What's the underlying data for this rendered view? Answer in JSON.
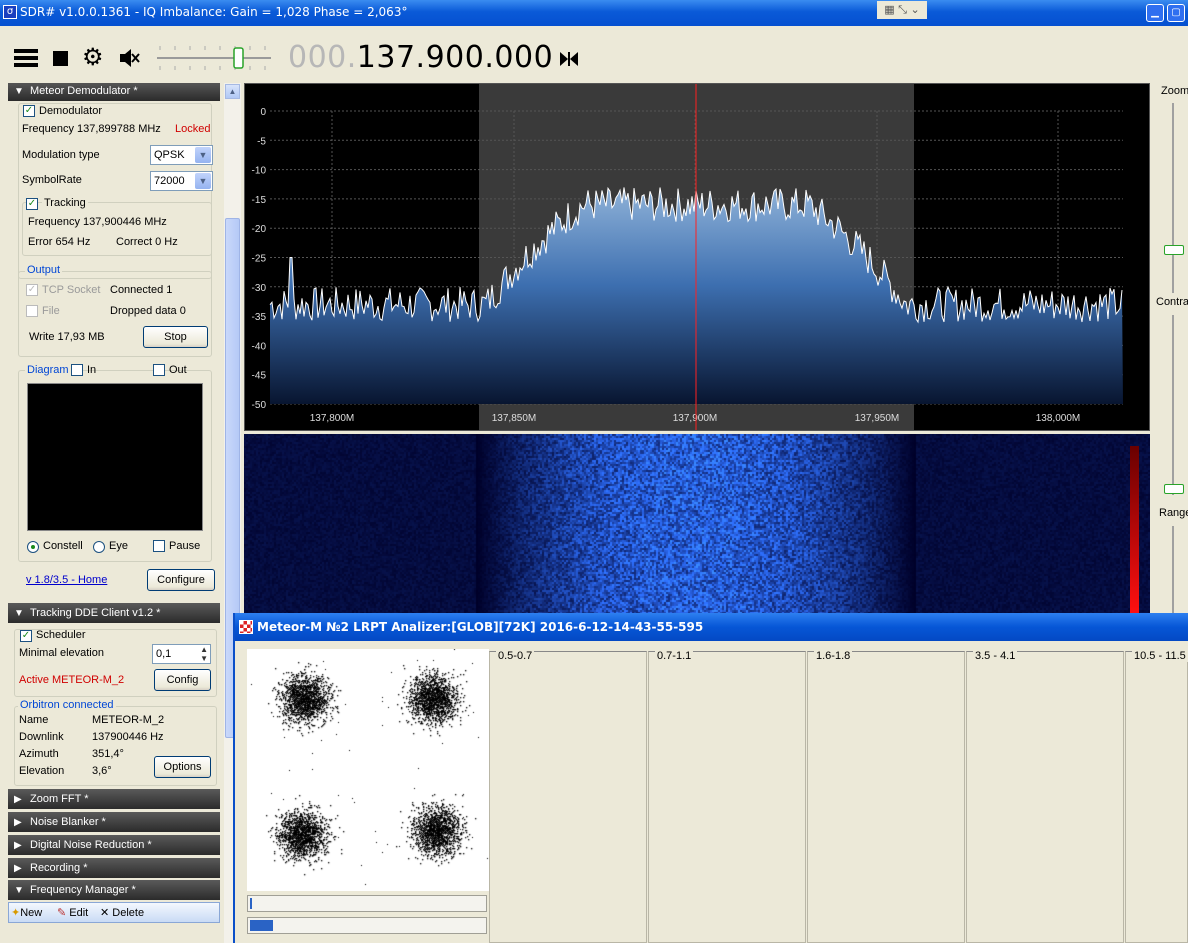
{
  "window": {
    "title": "SDR# v1.0.0.1361 - IQ Imbalance: Gain = 1,028 Phase = 2,063°"
  },
  "toolbar": {
    "freq_dim": "000.",
    "freq_main": "137.900.000"
  },
  "meteor": {
    "header": "Meteor Demodulator *",
    "demodulator_label": "Demodulator",
    "frequency_text": "Frequency 137,899788 MHz",
    "locked": "Locked",
    "modulation_label": "Modulation type",
    "modulation_value": "QPSK",
    "symbolrate_label": "SymbolRate",
    "symbolrate_value": "72000",
    "tracking_label": "Tracking",
    "tracking_freq": "Frequency 137,900446 MHz",
    "error": "Error 654 Hz",
    "correct": "Correct 0 Hz",
    "output_label": "Output",
    "tcp_label": "TCP Socket",
    "tcp_status": "Connected 1",
    "file_label": "File",
    "dropped": "Dropped data 0",
    "write": "Write 17,93 MB",
    "stop_btn": "Stop",
    "diagram_label": "Diagram",
    "in_label": "In",
    "out_label": "Out",
    "constell_label": "Constell",
    "eye_label": "Eye",
    "pause_label": "Pause",
    "home_link": "v 1.8/3.5 - Home",
    "configure_btn": "Configure"
  },
  "tracking": {
    "header": "Tracking DDE Client v1.2 *",
    "scheduler_label": "Scheduler",
    "min_elev_label": "Minimal elevation",
    "min_elev_value": "0,1",
    "active": "Active METEOR-M_2",
    "config_btn": "Config",
    "orbitron_label": "Orbitron connected",
    "name_label": "Name",
    "name_value": "METEOR-M_2",
    "downlink_label": "Downlink",
    "downlink_value": "137900446 Hz",
    "azimuth_label": "Azimuth",
    "azimuth_value": "351,4°",
    "elevation_label": "Elevation",
    "elevation_value": "3,6°",
    "options_btn": "Options"
  },
  "sections": [
    "Zoom FFT *",
    "Noise Blanker *",
    "Digital Noise Reduction *",
    "Recording *",
    "Frequency Manager *"
  ],
  "freqmgr": {
    "new": "New",
    "edit": "Edit",
    "delete": "Delete"
  },
  "right": {
    "zoom": "Zoom",
    "contrast": "Contras",
    "range": "Range"
  },
  "spectrum": {
    "y_ticks": [
      "0",
      "-5",
      "-10",
      "-15",
      "-20",
      "-25",
      "-30",
      "-35",
      "-40",
      "-45",
      "-50"
    ],
    "x_ticks": [
      "137,800M",
      "137,850M",
      "137,900M",
      "137,950M",
      "138,000M"
    ]
  },
  "analyzer": {
    "title": "Meteor-M №2 LRPT Analizer:[GLOB][72K] 2016-6-12-14-43-55-595",
    "channels": [
      "0.5-0.7",
      "0.7-1.1",
      "1.6-1.8",
      "3.5 - 4.1",
      "10.5 - 11.5"
    ]
  },
  "colors": {
    "accent": "#0a5ad8",
    "locked": "#d00000",
    "spectrum_fill": "#3f7fc0",
    "center_line": "#ff2020"
  }
}
